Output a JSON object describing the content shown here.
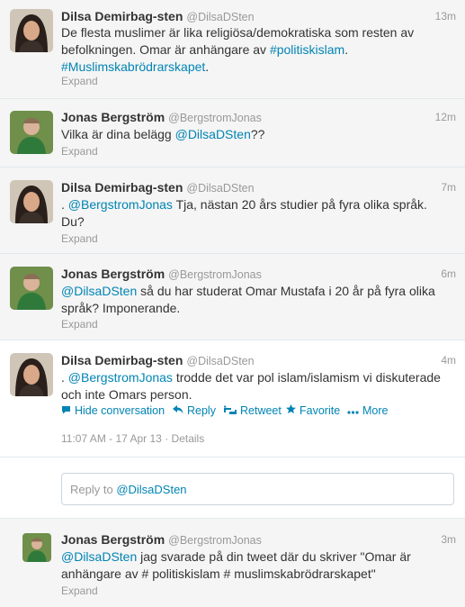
{
  "tweets": [
    {
      "name": "Dilsa Demirbag-sten",
      "handle": "@DilsaDSten",
      "time": "13m",
      "lines": [
        [
          {
            "t": "De flesta muslimer är lika religiösa/demokratiska som resten av"
          }
        ],
        [
          {
            "t": "befolkningen. Omar är anhängare av "
          },
          {
            "t": "#politiskislam",
            "link": true
          },
          {
            "t": "."
          }
        ],
        [
          {
            "t": "#Muslimskabrödrarskapet",
            "link": true
          },
          {
            "t": "."
          }
        ]
      ],
      "expand": "Expand"
    },
    {
      "name": "Jonas Bergström",
      "handle": "@BergstromJonas",
      "time": "12m",
      "lines": [
        [
          {
            "t": "Vilka är dina belägg "
          },
          {
            "t": "@DilsaDSten",
            "link": true
          },
          {
            "t": "??"
          }
        ]
      ],
      "expand": "Expand"
    },
    {
      "name": "Dilsa Demirbag-sten",
      "handle": "@DilsaDSten",
      "time": "7m",
      "lines": [
        [
          {
            "t": ". "
          },
          {
            "t": "@BergstromJonas",
            "link": true
          },
          {
            "t": " Tja, nästan 20 års studier på fyra olika språk."
          }
        ],
        [
          {
            "t": "Du?"
          }
        ]
      ],
      "expand": "Expand"
    },
    {
      "name": "Jonas Bergström",
      "handle": "@BergstromJonas",
      "time": "6m",
      "lines": [
        [
          {
            "t": "@DilsaDSten",
            "link": true
          },
          {
            "t": " så du har studerat Omar Mustafa i 20 år på fyra olika"
          }
        ],
        [
          {
            "t": "språk? Imponerande."
          }
        ]
      ],
      "expand": "Expand"
    },
    {
      "name": "Dilsa Demirbag-sten",
      "handle": "@DilsaDSten",
      "time": "4m",
      "lines": [
        [
          {
            "t": ". "
          },
          {
            "t": "@BergstromJonas",
            "link": true
          },
          {
            "t": " trodde det var pol islam/islamism vi diskuterade"
          }
        ],
        [
          {
            "t": "och inte Omars person."
          }
        ]
      ]
    },
    {
      "name": "Jonas Bergström",
      "handle": "@BergstromJonas",
      "time": "3m",
      "lines": [
        [
          {
            "t": "@DilsaDSten",
            "link": true
          },
          {
            "t": " jag svarade på din tweet där du skriver \"Omar är"
          }
        ],
        [
          {
            "t": "anhängare av # politiskislam # muslimskabrödrarskapet\""
          }
        ]
      ],
      "expand": "Expand"
    }
  ],
  "actions": {
    "hide_conversation": "Hide conversation",
    "reply": "Reply",
    "retweet": "Retweet",
    "favorite": "Favorite",
    "more": "More"
  },
  "tweet_meta": {
    "timestamp": "11:07 AM - 17 Apr 13",
    "separator": "·",
    "details": "Details"
  },
  "reply_box": {
    "prefix": "Reply to ",
    "mention": "@DilsaDSten"
  },
  "icons": {
    "hide_conversation": "speech-bubble-icon",
    "reply": "reply-arrow-icon",
    "retweet": "retweet-icon",
    "favorite": "star-icon",
    "more": "more-dots-icon"
  },
  "colors": {
    "link": "#0084b4",
    "muted": "#999999",
    "text": "#333333",
    "background": "#f5f5f5",
    "expanded_background": "#ffffff"
  }
}
